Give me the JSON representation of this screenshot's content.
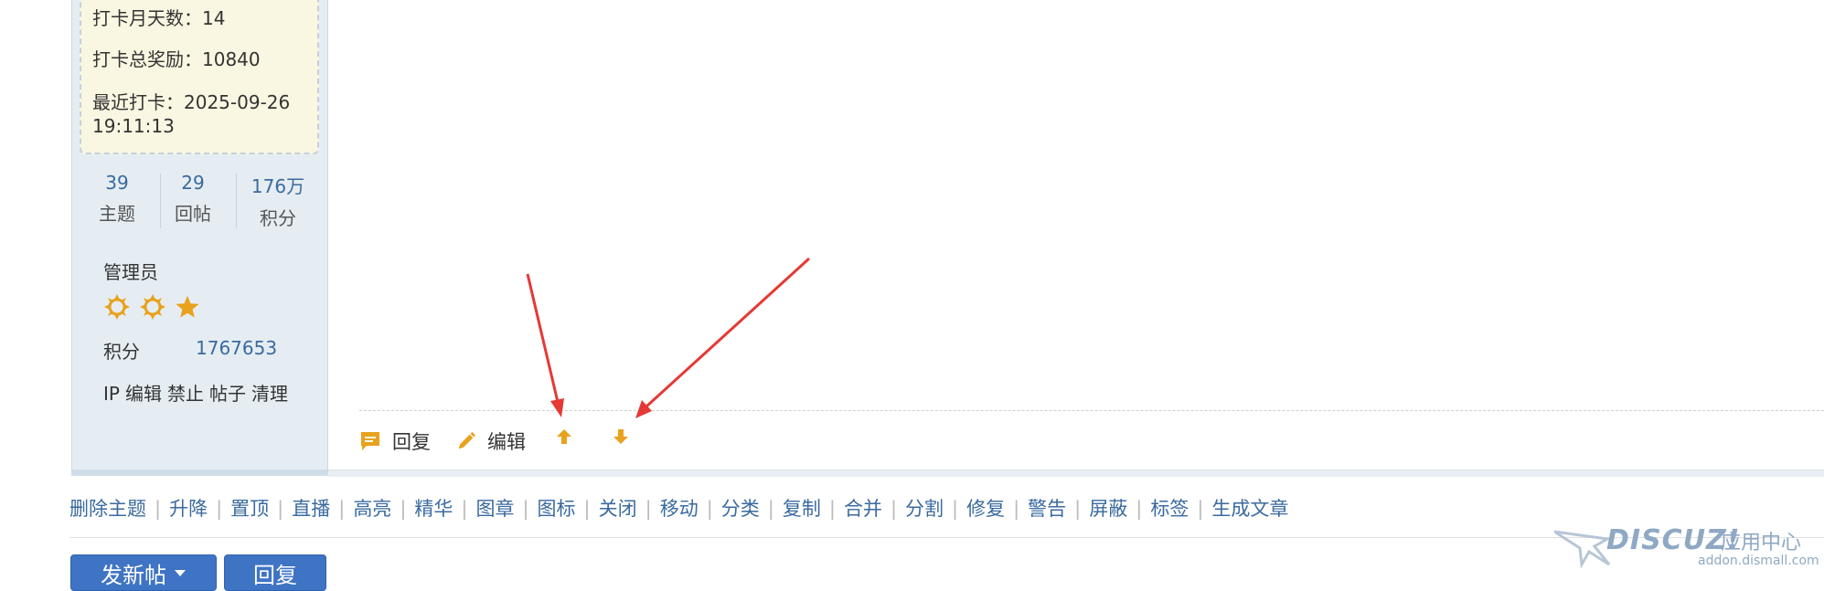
{
  "user_panel": {
    "checkin": {
      "month_days": "打卡月天数：14",
      "total_reward": "打卡总奖励：10840",
      "last_checkin_line1": "最近打卡：2025-09-26",
      "last_checkin_line2": "19:11:13"
    },
    "stats": [
      {
        "value": "39",
        "label": "主题"
      },
      {
        "value": "29",
        "label": "回帖"
      },
      {
        "value": "176万",
        "label": "积分"
      }
    ],
    "group": "管理员",
    "stars": [
      "sun-icon",
      "sun-icon",
      "star-icon"
    ],
    "points_label": "积分",
    "points_value": "1767653",
    "admin_links": [
      "IP",
      "编辑",
      "禁止",
      "帖子",
      "清理"
    ]
  },
  "post_actions": {
    "reply_label": "回复",
    "edit_label": "编辑",
    "icons": [
      "reply-icon",
      "edit-icon",
      "thumb-up-arrow-icon",
      "thumb-down-arrow-icon"
    ]
  },
  "mod_bar": [
    "删除主题",
    "升降",
    "置顶",
    "直播",
    "高亮",
    "精华",
    "图章",
    "图标",
    "关闭",
    "移动",
    "分类",
    "复制",
    "合并",
    "分割",
    "修复",
    "警告",
    "屏蔽",
    "标签",
    "生成文章"
  ],
  "buttons": {
    "new_post": "发新帖",
    "reply": "回复"
  },
  "watermark": {
    "brand": "DISCUZ!",
    "brand_cn": "应用中心",
    "url": "addon.dismall.com"
  },
  "colors": {
    "accent": "#3f74c4",
    "link": "#3a6a9f",
    "icon_orange": "#e8a21d",
    "annotation_red": "#e53935"
  }
}
